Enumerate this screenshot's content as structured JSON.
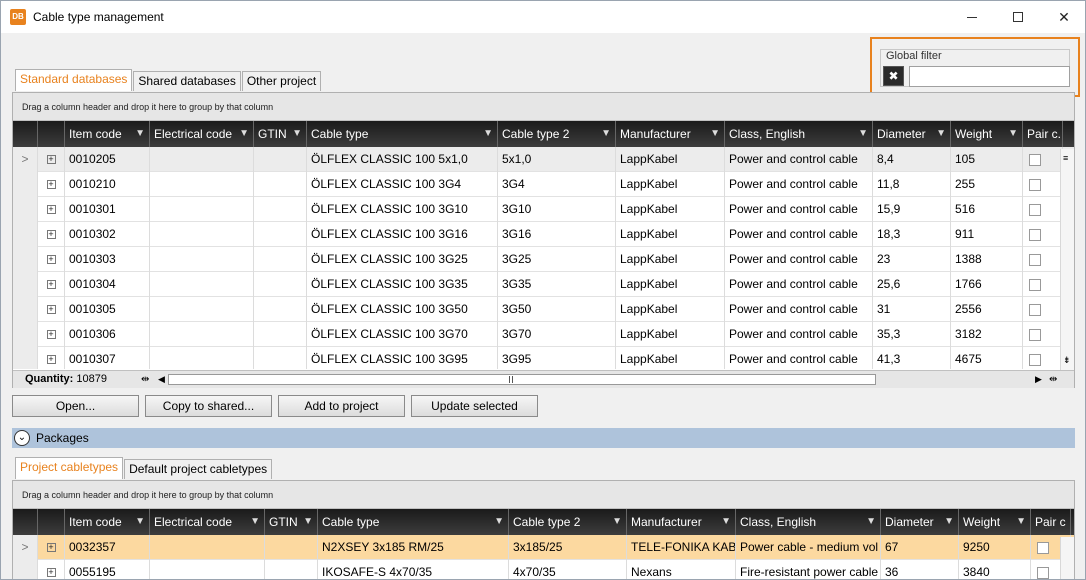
{
  "window": {
    "icon_text": "DB",
    "title": "Cable type management"
  },
  "global_filter": {
    "label": "Global filter",
    "value": ""
  },
  "top_tabs": [
    "Standard databases",
    "Shared databases",
    "Other project"
  ],
  "top_grid": {
    "group_hint": "Drag a column header and drop it here to group by that column",
    "columns": [
      "Item code",
      "Electrical code",
      "GTIN",
      "Cable type",
      "Cable type 2",
      "Manufacturer",
      "Class, English",
      "Diameter",
      "Weight",
      "Pair c..."
    ],
    "rows": [
      [
        "0010205",
        "",
        "",
        "ÖLFLEX CLASSIC 100 5x1,0",
        "5x1,0",
        "LappKabel",
        "Power and control cable",
        "8,4",
        "105"
      ],
      [
        "0010210",
        "",
        "",
        "ÖLFLEX CLASSIC 100 3G4",
        "3G4",
        "LappKabel",
        "Power and control cable",
        "11,8",
        "255"
      ],
      [
        "0010301",
        "",
        "",
        "ÖLFLEX CLASSIC 100 3G10",
        "3G10",
        "LappKabel",
        "Power and control cable",
        "15,9",
        "516"
      ],
      [
        "0010302",
        "",
        "",
        "ÖLFLEX CLASSIC 100 3G16",
        "3G16",
        "LappKabel",
        "Power and control cable",
        "18,3",
        "911"
      ],
      [
        "0010303",
        "",
        "",
        "ÖLFLEX CLASSIC 100 3G25",
        "3G25",
        "LappKabel",
        "Power and control cable",
        "23",
        "1388"
      ],
      [
        "0010304",
        "",
        "",
        "ÖLFLEX CLASSIC 100 3G35",
        "3G35",
        "LappKabel",
        "Power and control cable",
        "25,6",
        "1766"
      ],
      [
        "0010305",
        "",
        "",
        "ÖLFLEX CLASSIC 100 3G50",
        "3G50",
        "LappKabel",
        "Power and control cable",
        "31",
        "2556"
      ],
      [
        "0010306",
        "",
        "",
        "ÖLFLEX CLASSIC 100 3G70",
        "3G70",
        "LappKabel",
        "Power and control cable",
        "35,3",
        "3182"
      ],
      [
        "0010307",
        "",
        "",
        "ÖLFLEX CLASSIC 100 3G95",
        "3G95",
        "LappKabel",
        "Power and control cable",
        "41,3",
        "4675"
      ]
    ],
    "quantity_label": "Quantity:",
    "quantity_value": "10879"
  },
  "actions": {
    "open": "Open...",
    "copy_to_shared": "Copy to shared...",
    "add_to_project": "Add to project",
    "update_selected": "Update selected"
  },
  "packages": {
    "label": "Packages"
  },
  "bottom_tabs": [
    "Project cabletypes",
    "Default project cabletypes"
  ],
  "bottom_grid": {
    "group_hint": "Drag a column header and drop it here to group by that column",
    "columns": [
      "Item code",
      "Electrical code",
      "GTIN",
      "Cable type",
      "Cable type 2",
      "Manufacturer",
      "Class, English",
      "Diameter",
      "Weight",
      "Pair c"
    ],
    "rows": [
      [
        "0032357",
        "",
        "",
        "N2XSEY 3x185 RM/25",
        "3x185/25",
        "TELE-FONIKA KABL",
        "Power cable - medium vol",
        "67",
        "9250"
      ],
      [
        "0055195",
        "",
        "",
        "IKOSAFE-S 4x70/35",
        "4x70/35",
        "Nexans",
        "Fire-resistant power cable",
        "36",
        "3840"
      ]
    ]
  },
  "colors": {
    "accent": "#e8821e",
    "packages_bar": "#aec3db",
    "highlight_row": "#fcd9a0"
  }
}
